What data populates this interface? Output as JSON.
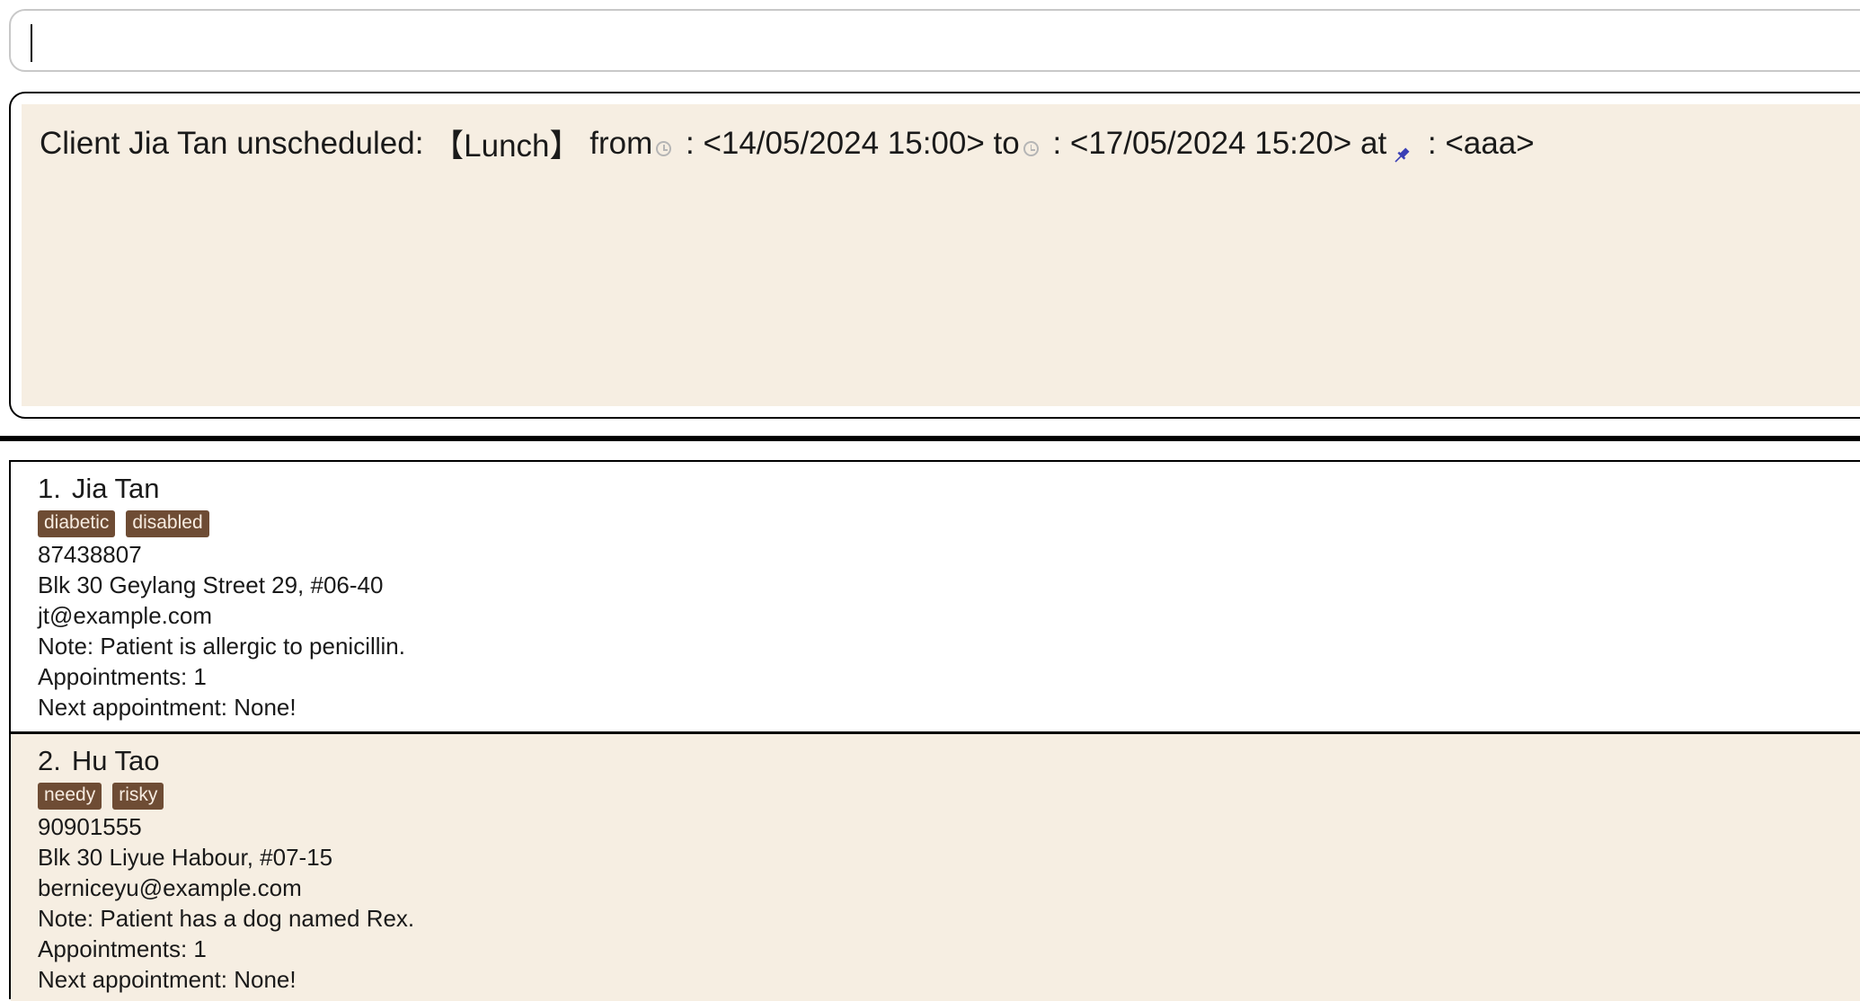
{
  "command_box": {
    "value": ""
  },
  "result": {
    "prefix": "Client Jia Tan unscheduled: ",
    "title": "【Lunch】",
    "from_label": " from",
    "from_value": " : <14/05/2024 15:00> to",
    "to_value": " : <17/05/2024 15:20> at",
    "at_value": " : <aaa>",
    "icons": {
      "time": "clock-icon",
      "location": "pushpin-icon"
    },
    "pin_color": "#3a3fb5"
  },
  "clients": [
    {
      "index": "1.",
      "name": "Jia Tan",
      "tags": [
        "diabetic",
        "disabled"
      ],
      "phone": "87438807",
      "address": "Blk 30 Geylang Street 29, #06-40",
      "email": "jt@example.com",
      "note": "Note: Patient is allergic to penicillin.",
      "appointments": "Appointments: 1",
      "next_appointment": "Next appointment: None!"
    },
    {
      "index": "2.",
      "name": "Hu Tao",
      "tags": [
        "needy",
        "risky"
      ],
      "phone": "90901555",
      "address": "Blk 30 Liyue Habour, #07-15",
      "email": "berniceyu@example.com",
      "note": "Note: Patient has a dog named Rex.",
      "appointments": "Appointments: 1",
      "next_appointment": "Next appointment: None!"
    }
  ],
  "colors": {
    "panel_bg": "#f6eee2",
    "tag_bg": "#6e4c34",
    "tag_text": "#f7ece1"
  }
}
